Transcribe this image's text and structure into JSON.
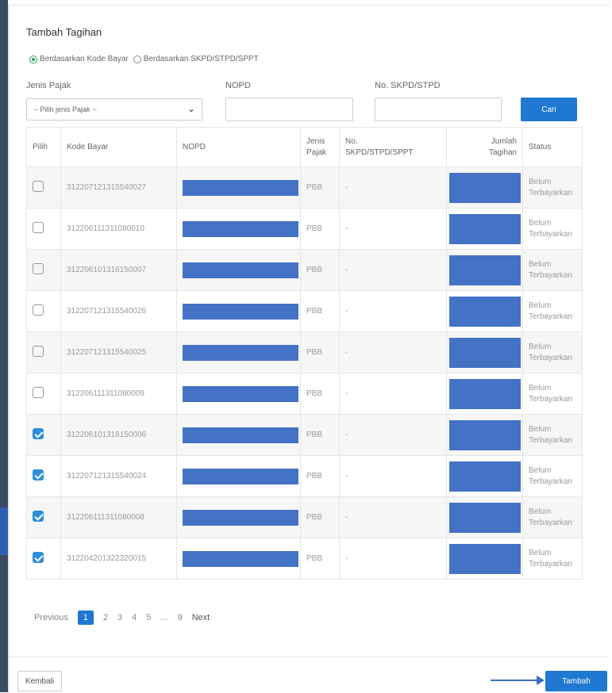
{
  "modal": {
    "title": "Tambah Tagihan",
    "radio_kode_bayar": "Berdasarkan Kode Bayar",
    "radio_skpd": "Berdasarkan SKPD/STPD/SPPT"
  },
  "filters": {
    "jenis_pajak_label": "Jenis Pajak",
    "jenis_pajak_placeholder": "-- Pilih jenis Pajak --",
    "nopd_label": "NOPD",
    "nopd_value": "",
    "skpd_label": "No. SKPD/STPD",
    "skpd_value": "",
    "cari_label": "Cari"
  },
  "table": {
    "headers": {
      "pilih": "Pilih",
      "kode_bayar": "Kode Bayar",
      "nopd": "NOPD",
      "jenis_pajak_1": "Jenis",
      "jenis_pajak_2": "Pajak",
      "no_skpd_1": "No.",
      "no_skpd_2": "SKPD/STPD/SPPT",
      "jumlah_1": "Jumlah",
      "jumlah_2": "Tagihan",
      "status": "Status"
    },
    "rows": [
      {
        "checked": false,
        "kode_bayar": "312207121315540027",
        "jenis": "PBB",
        "no_skpd": "-",
        "status_1": "Belum",
        "status_2": "Terbayarkan"
      },
      {
        "checked": false,
        "kode_bayar": "312206111311080010",
        "jenis": "PBB",
        "no_skpd": "-",
        "status_1": "Belum",
        "status_2": "Terbayarkan"
      },
      {
        "checked": false,
        "kode_bayar": "312206101316150007",
        "jenis": "PBB",
        "no_skpd": "-",
        "status_1": "Belum",
        "status_2": "Terbayarkan"
      },
      {
        "checked": false,
        "kode_bayar": "312207121315540026",
        "jenis": "PBB",
        "no_skpd": "-",
        "status_1": "Belum",
        "status_2": "Terbayarkan"
      },
      {
        "checked": false,
        "kode_bayar": "312207121315540025",
        "jenis": "PBB",
        "no_skpd": "-",
        "status_1": "Belum",
        "status_2": "Terbayarkan"
      },
      {
        "checked": false,
        "kode_bayar": "312206111311080009",
        "jenis": "PBB",
        "no_skpd": "-",
        "status_1": "Belum",
        "status_2": "Terbayarkan"
      },
      {
        "checked": true,
        "kode_bayar": "312206101316150006",
        "jenis": "PBB",
        "no_skpd": "-",
        "status_1": "Belum",
        "status_2": "Terbayarkan"
      },
      {
        "checked": true,
        "kode_bayar": "312207121315540024",
        "jenis": "PBB",
        "no_skpd": "-",
        "status_1": "Belum",
        "status_2": "Terbayarkan"
      },
      {
        "checked": true,
        "kode_bayar": "312206111311080008",
        "jenis": "PBB",
        "no_skpd": "-",
        "status_1": "Belum",
        "status_2": "Terbayarkan"
      },
      {
        "checked": true,
        "kode_bayar": "312204201322320015",
        "jenis": "PBB",
        "no_skpd": "-",
        "status_1": "Belum",
        "status_2": "Terbayarkan"
      }
    ]
  },
  "pagination": {
    "previous": "Previous",
    "pages": [
      "1",
      "2",
      "3",
      "4",
      "5"
    ],
    "ellipsis": "...",
    "last": "9",
    "next": "Next",
    "current": "1"
  },
  "footer": {
    "kembali": "Kembali",
    "tambah": "Tambah"
  },
  "colors": {
    "primary": "#1f78d1",
    "radio_active": "#2e9b58",
    "redaction": "#4472c4",
    "checkbox_checked": "#2e8fd8"
  }
}
